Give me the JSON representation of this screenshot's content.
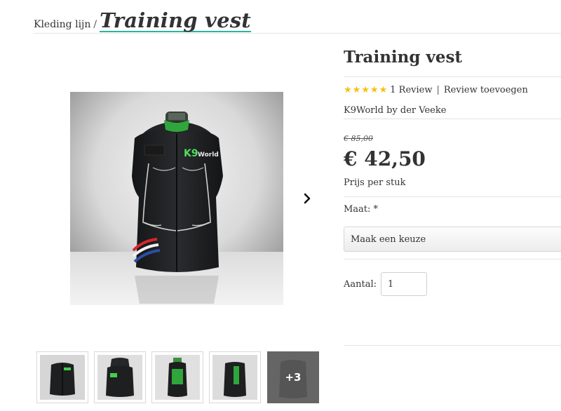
{
  "breadcrumb": {
    "parent": "Kleding lijn",
    "separator": "/",
    "current": "Training vest"
  },
  "product": {
    "title": "Training vest",
    "rating": {
      "stars": 5,
      "review_count_label": "1 Review",
      "separator": "|",
      "add_review_label": "Review toevoegen"
    },
    "brand": "K9World by der Veeke",
    "old_price": "€ 85,00",
    "price": "€ 42,50",
    "price_unit": "Prijs per stuk",
    "size_label": "Maat: *",
    "size_select_value": "Maak een keuze",
    "quantity_label": "Aantal:",
    "quantity_value": "1"
  },
  "gallery": {
    "main_image_icon": "training-vest-photo",
    "next_icon": "chevron-right-icon",
    "thumbnails": [
      {
        "icon": "vest-front-thumbnail"
      },
      {
        "icon": "vest-hood-thumbnail"
      },
      {
        "icon": "vest-side-thumbnail"
      },
      {
        "icon": "vest-side-green-thumbnail"
      }
    ],
    "more_label": "+3"
  },
  "colors": {
    "accent": "#2bb3a4",
    "star": "#f4c20d",
    "vest": "#1e1f21",
    "vest_green": "#3fd14b"
  }
}
